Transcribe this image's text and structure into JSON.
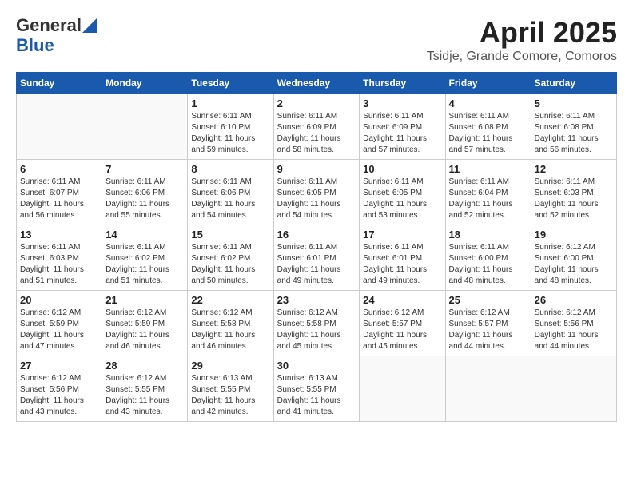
{
  "header": {
    "logo_general": "General",
    "logo_blue": "Blue",
    "month_title": "April 2025",
    "location": "Tsidje, Grande Comore, Comoros"
  },
  "days_of_week": [
    "Sunday",
    "Monday",
    "Tuesday",
    "Wednesday",
    "Thursday",
    "Friday",
    "Saturday"
  ],
  "weeks": [
    [
      {
        "day": "",
        "info": ""
      },
      {
        "day": "",
        "info": ""
      },
      {
        "day": "1",
        "info": "Sunrise: 6:11 AM\nSunset: 6:10 PM\nDaylight: 11 hours and 59 minutes."
      },
      {
        "day": "2",
        "info": "Sunrise: 6:11 AM\nSunset: 6:09 PM\nDaylight: 11 hours and 58 minutes."
      },
      {
        "day": "3",
        "info": "Sunrise: 6:11 AM\nSunset: 6:09 PM\nDaylight: 11 hours and 57 minutes."
      },
      {
        "day": "4",
        "info": "Sunrise: 6:11 AM\nSunset: 6:08 PM\nDaylight: 11 hours and 57 minutes."
      },
      {
        "day": "5",
        "info": "Sunrise: 6:11 AM\nSunset: 6:08 PM\nDaylight: 11 hours and 56 minutes."
      }
    ],
    [
      {
        "day": "6",
        "info": "Sunrise: 6:11 AM\nSunset: 6:07 PM\nDaylight: 11 hours and 56 minutes."
      },
      {
        "day": "7",
        "info": "Sunrise: 6:11 AM\nSunset: 6:06 PM\nDaylight: 11 hours and 55 minutes."
      },
      {
        "day": "8",
        "info": "Sunrise: 6:11 AM\nSunset: 6:06 PM\nDaylight: 11 hours and 54 minutes."
      },
      {
        "day": "9",
        "info": "Sunrise: 6:11 AM\nSunset: 6:05 PM\nDaylight: 11 hours and 54 minutes."
      },
      {
        "day": "10",
        "info": "Sunrise: 6:11 AM\nSunset: 6:05 PM\nDaylight: 11 hours and 53 minutes."
      },
      {
        "day": "11",
        "info": "Sunrise: 6:11 AM\nSunset: 6:04 PM\nDaylight: 11 hours and 52 minutes."
      },
      {
        "day": "12",
        "info": "Sunrise: 6:11 AM\nSunset: 6:03 PM\nDaylight: 11 hours and 52 minutes."
      }
    ],
    [
      {
        "day": "13",
        "info": "Sunrise: 6:11 AM\nSunset: 6:03 PM\nDaylight: 11 hours and 51 minutes."
      },
      {
        "day": "14",
        "info": "Sunrise: 6:11 AM\nSunset: 6:02 PM\nDaylight: 11 hours and 51 minutes."
      },
      {
        "day": "15",
        "info": "Sunrise: 6:11 AM\nSunset: 6:02 PM\nDaylight: 11 hours and 50 minutes."
      },
      {
        "day": "16",
        "info": "Sunrise: 6:11 AM\nSunset: 6:01 PM\nDaylight: 11 hours and 49 minutes."
      },
      {
        "day": "17",
        "info": "Sunrise: 6:11 AM\nSunset: 6:01 PM\nDaylight: 11 hours and 49 minutes."
      },
      {
        "day": "18",
        "info": "Sunrise: 6:11 AM\nSunset: 6:00 PM\nDaylight: 11 hours and 48 minutes."
      },
      {
        "day": "19",
        "info": "Sunrise: 6:12 AM\nSunset: 6:00 PM\nDaylight: 11 hours and 48 minutes."
      }
    ],
    [
      {
        "day": "20",
        "info": "Sunrise: 6:12 AM\nSunset: 5:59 PM\nDaylight: 11 hours and 47 minutes."
      },
      {
        "day": "21",
        "info": "Sunrise: 6:12 AM\nSunset: 5:59 PM\nDaylight: 11 hours and 46 minutes."
      },
      {
        "day": "22",
        "info": "Sunrise: 6:12 AM\nSunset: 5:58 PM\nDaylight: 11 hours and 46 minutes."
      },
      {
        "day": "23",
        "info": "Sunrise: 6:12 AM\nSunset: 5:58 PM\nDaylight: 11 hours and 45 minutes."
      },
      {
        "day": "24",
        "info": "Sunrise: 6:12 AM\nSunset: 5:57 PM\nDaylight: 11 hours and 45 minutes."
      },
      {
        "day": "25",
        "info": "Sunrise: 6:12 AM\nSunset: 5:57 PM\nDaylight: 11 hours and 44 minutes."
      },
      {
        "day": "26",
        "info": "Sunrise: 6:12 AM\nSunset: 5:56 PM\nDaylight: 11 hours and 44 minutes."
      }
    ],
    [
      {
        "day": "27",
        "info": "Sunrise: 6:12 AM\nSunset: 5:56 PM\nDaylight: 11 hours and 43 minutes."
      },
      {
        "day": "28",
        "info": "Sunrise: 6:12 AM\nSunset: 5:55 PM\nDaylight: 11 hours and 43 minutes."
      },
      {
        "day": "29",
        "info": "Sunrise: 6:13 AM\nSunset: 5:55 PM\nDaylight: 11 hours and 42 minutes."
      },
      {
        "day": "30",
        "info": "Sunrise: 6:13 AM\nSunset: 5:55 PM\nDaylight: 11 hours and 41 minutes."
      },
      {
        "day": "",
        "info": ""
      },
      {
        "day": "",
        "info": ""
      },
      {
        "day": "",
        "info": ""
      }
    ]
  ]
}
